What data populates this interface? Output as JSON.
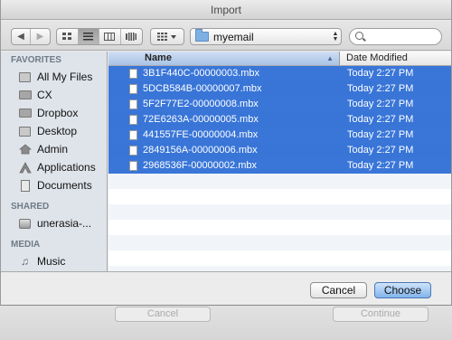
{
  "window": {
    "title": "Import"
  },
  "toolbar": {
    "back_glyph": "◀",
    "forward_glyph": "▶",
    "path_value": "myemail",
    "search_placeholder": ""
  },
  "sidebar": {
    "favorites_header": "FAVORITES",
    "favorites": [
      {
        "label": "All My Files",
        "icon": "all-files-icon"
      },
      {
        "label": "CX",
        "icon": "folder-icon"
      },
      {
        "label": "Dropbox",
        "icon": "dropbox-folder-icon"
      },
      {
        "label": "Desktop",
        "icon": "desktop-icon"
      },
      {
        "label": "Admin",
        "icon": "home-icon"
      },
      {
        "label": "Applications",
        "icon": "applications-icon"
      },
      {
        "label": "Documents",
        "icon": "documents-icon"
      }
    ],
    "shared_header": "SHARED",
    "shared": [
      {
        "label": "unerasia-...",
        "icon": "computer-icon"
      }
    ],
    "media_header": "MEDIA",
    "media": [
      {
        "label": "Music",
        "icon": "music-icon"
      }
    ]
  },
  "filelist": {
    "columns": {
      "name": "Name",
      "date": "Date Modified"
    },
    "rows": [
      {
        "name": "3B1F440C-00000003.mbx",
        "date": "Today 2:27 PM"
      },
      {
        "name": "5DCB584B-00000007.mbx",
        "date": "Today 2:27 PM"
      },
      {
        "name": "5F2F77E2-00000008.mbx",
        "date": "Today 2:27 PM"
      },
      {
        "name": "72E6263A-00000005.mbx",
        "date": "Today 2:27 PM"
      },
      {
        "name": "441557FE-00000004.mbx",
        "date": "Today 2:27 PM"
      },
      {
        "name": "2849156A-00000006.mbx",
        "date": "Today 2:27 PM"
      },
      {
        "name": "2968536F-00000002.mbx",
        "date": "Today 2:27 PM"
      }
    ]
  },
  "buttons": {
    "cancel": "Cancel",
    "choose": "Choose"
  },
  "background_sheet": {
    "cancel": "Cancel",
    "continue": "Continue"
  }
}
